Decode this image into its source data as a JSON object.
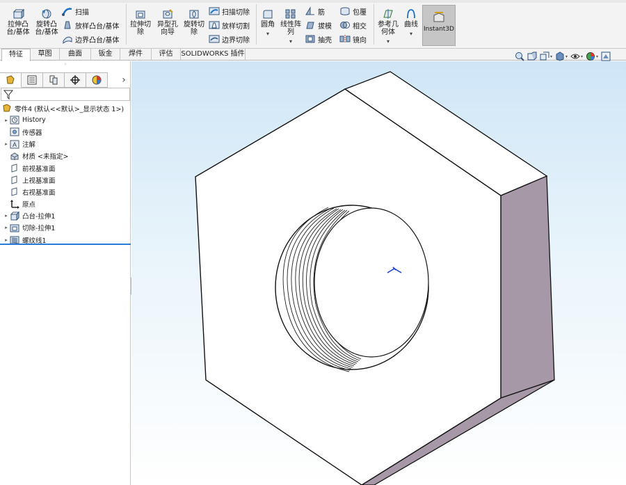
{
  "ribbon": {
    "features": {
      "extrude_boss": "拉伸凸\n台/基体",
      "revolve_boss": "旋转凸\n台/基体",
      "sweep": "扫描",
      "loft_boss": "放样凸台/基体",
      "boundary_boss": "边界凸台/基体",
      "extrude_cut": "拉伸切\n除",
      "hole_wizard": "异型孔\n向导",
      "revolve_cut": "旋转切\n除",
      "sweep_cut": "扫描切除",
      "loft_cut": "放样切割",
      "boundary_cut": "边界切除",
      "fillet": "圆角",
      "linear_pattern": "线性阵\n列",
      "rib": "筋",
      "draft": "拔模",
      "shell": "抽壳",
      "wrap": "包覆",
      "intersect": "相交",
      "mirror": "镜向",
      "ref_geometry": "参考几\n何体",
      "curves": "曲线",
      "instant3d": "Instant3D"
    },
    "tabs": [
      "特征",
      "草图",
      "曲面",
      "钣金",
      "焊件",
      "评估",
      "SOLIDWORKS 插件"
    ]
  },
  "tree": {
    "root": "零件4 (默认<<默认>_显示状态 1>)",
    "items": [
      {
        "label": "History",
        "icon": "history-icon",
        "expand": true
      },
      {
        "label": "传感器",
        "icon": "sensor-icon",
        "expand": false
      },
      {
        "label": "注解",
        "icon": "annotation-icon",
        "expand": true
      },
      {
        "label": "材质 <未指定>",
        "icon": "material-icon",
        "expand": false
      },
      {
        "label": "前视基准面",
        "icon": "plane-icon",
        "expand": false
      },
      {
        "label": "上视基准面",
        "icon": "plane-icon",
        "expand": false
      },
      {
        "label": "右视基准面",
        "icon": "plane-icon",
        "expand": false
      },
      {
        "label": "原点",
        "icon": "origin-icon",
        "expand": false
      },
      {
        "label": "凸台-拉伸1",
        "icon": "extrude-feature-icon",
        "expand": true
      },
      {
        "label": "切除-拉伸1",
        "icon": "cut-feature-icon",
        "expand": true
      },
      {
        "label": "螺纹线1",
        "icon": "thread-feature-icon",
        "expand": true
      }
    ]
  },
  "colors": {
    "accent": "#2a7bd6",
    "face_side": "#a698a6",
    "model_face": "#ffffff"
  }
}
